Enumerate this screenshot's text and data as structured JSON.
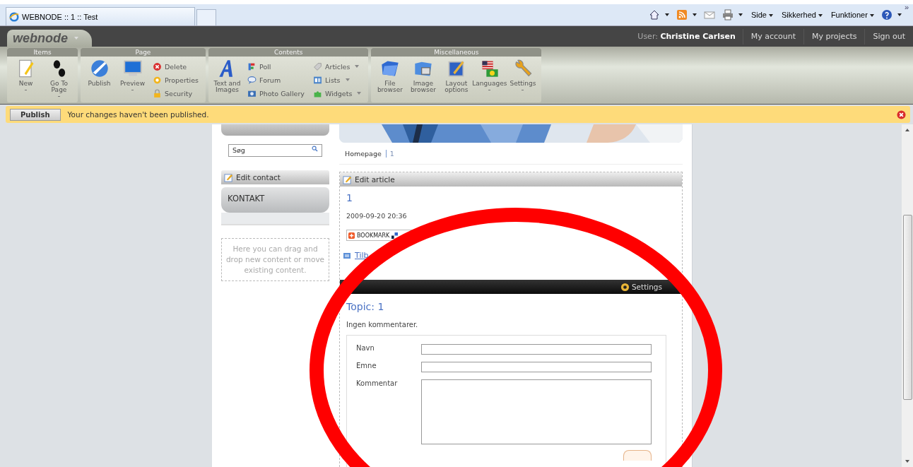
{
  "browser": {
    "tab_title": "WEBNODE :: 1 :: Test",
    "commands": [
      "Side",
      "Sikkerhed",
      "Funktioner"
    ],
    "overflow": "»"
  },
  "header": {
    "logo": "webnode",
    "user_label": "User:",
    "user_name": "Christine Carlsen",
    "links": [
      "My account",
      "My projects",
      "Sign out"
    ]
  },
  "ribbon": [
    {
      "title": "Items",
      "columns": [
        {
          "kind": "large",
          "items": [
            {
              "label": "New",
              "dropdown": true
            }
          ]
        },
        {
          "kind": "large",
          "items": [
            {
              "label": "Go To Page",
              "dropdown": true
            }
          ]
        }
      ]
    },
    {
      "title": "Page",
      "columns": [
        {
          "kind": "large",
          "items": [
            {
              "label": "Publish",
              "dropdown": false
            }
          ]
        },
        {
          "kind": "large",
          "items": [
            {
              "label": "Preview",
              "dropdown": true
            }
          ]
        },
        {
          "kind": "small",
          "items": [
            {
              "label": "Delete",
              "dropdown": false
            },
            {
              "label": "Properties",
              "dropdown": false
            },
            {
              "label": "Security",
              "dropdown": false
            }
          ]
        }
      ]
    },
    {
      "title": "Contents",
      "columns": [
        {
          "kind": "large",
          "items": [
            {
              "label": "Text and Images",
              "dropdown": false
            }
          ]
        },
        {
          "kind": "small",
          "items": [
            {
              "label": "Poll",
              "dropdown": false
            },
            {
              "label": "Forum",
              "dropdown": false
            },
            {
              "label": "Photo Gallery",
              "dropdown": false
            }
          ]
        },
        {
          "kind": "small",
          "items": [
            {
              "label": "Articles",
              "dropdown": true
            },
            {
              "label": "Lists",
              "dropdown": true
            },
            {
              "label": "Widgets",
              "dropdown": true
            }
          ]
        }
      ]
    },
    {
      "title": "Miscellaneous",
      "columns": [
        {
          "kind": "large",
          "items": [
            {
              "label": "File browser",
              "dropdown": false
            }
          ]
        },
        {
          "kind": "large",
          "items": [
            {
              "label": "Image browser",
              "dropdown": false
            }
          ]
        },
        {
          "kind": "large",
          "items": [
            {
              "label": "Layout options",
              "dropdown": false
            }
          ]
        },
        {
          "kind": "large",
          "items": [
            {
              "label": "Languages",
              "dropdown": true
            }
          ]
        },
        {
          "kind": "large",
          "items": [
            {
              "label": "Settings",
              "dropdown": true
            }
          ]
        }
      ]
    }
  ],
  "notification": {
    "button": "Publish",
    "message": "Your changes haven't been published."
  },
  "sidebar": {
    "search": {
      "placeholder": "Søg"
    },
    "edit_label": "Edit contact",
    "box_title": "KONTAKT",
    "drop_hint": "Here you can drag and drop new content or move existing content."
  },
  "main": {
    "breadcrumb": [
      "Homepage",
      "1"
    ],
    "edit_label": "Edit article",
    "article_title": "1",
    "date": "2009-09-20 20:36",
    "bookmark": "BOOKMARK",
    "back_link": "Tilb",
    "forum": {
      "settings": "Settings",
      "topic": "Topic: 1",
      "no_comments": "Ingen kommentarer.",
      "fields": [
        {
          "label": "Navn",
          "kind": "input"
        },
        {
          "label": "Emne",
          "kind": "input"
        },
        {
          "label": "Kommentar",
          "kind": "textarea"
        }
      ]
    }
  }
}
